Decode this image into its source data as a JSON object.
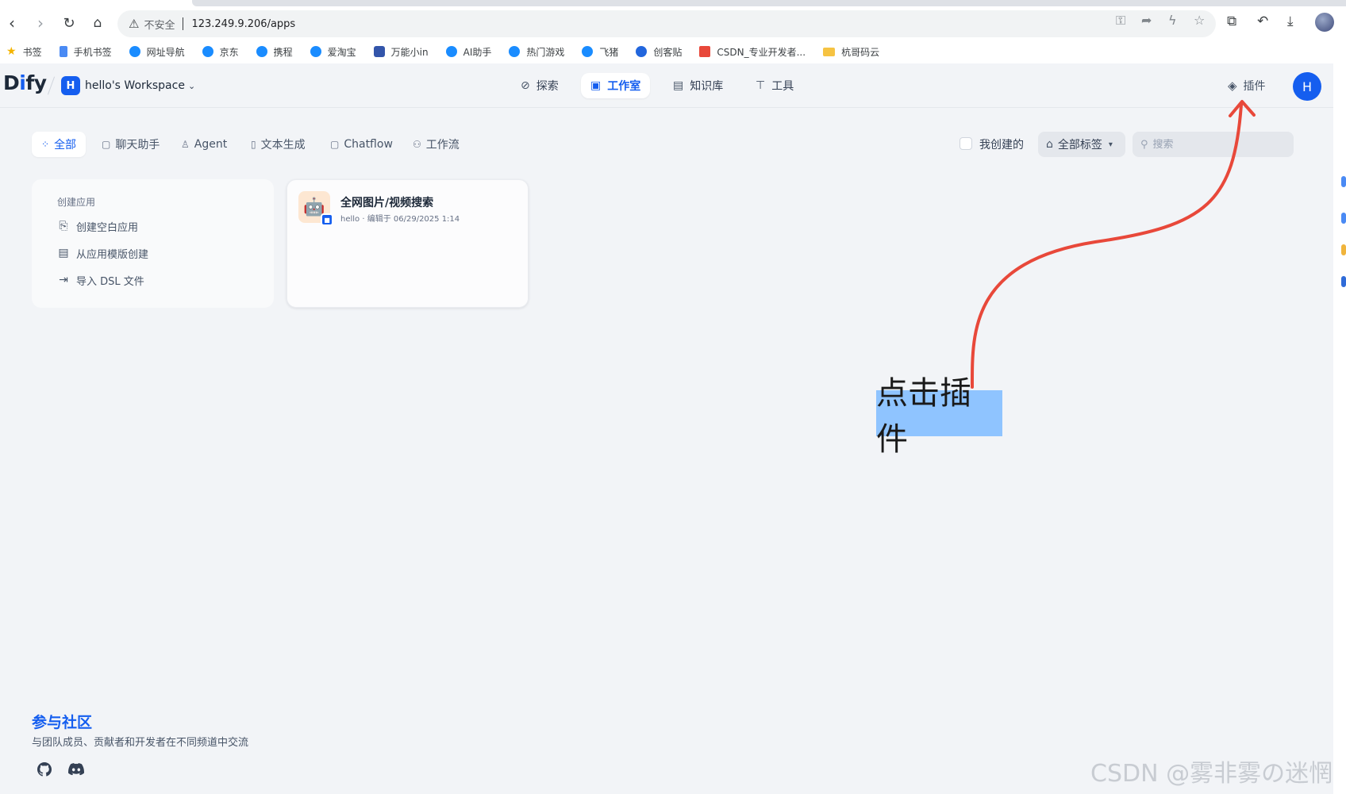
{
  "browser": {
    "insecure_label": "不安全",
    "url": "123.249.9.206/apps",
    "bookmarks": [
      {
        "label": "书签",
        "icon": "star-icon"
      },
      {
        "label": "手机书签",
        "icon": "phone-icon"
      },
      {
        "label": "网址导航",
        "icon": "edge-icon"
      },
      {
        "label": "京东",
        "icon": "edge-icon"
      },
      {
        "label": "携程",
        "icon": "edge-icon"
      },
      {
        "label": "爱淘宝",
        "icon": "edge-icon"
      },
      {
        "label": "万能小in",
        "icon": "robot-icon"
      },
      {
        "label": "AI助手",
        "icon": "edge-icon"
      },
      {
        "label": "热门游戏",
        "icon": "edge-icon"
      },
      {
        "label": "飞猪",
        "icon": "edge-icon"
      },
      {
        "label": "创客贴",
        "icon": "creator-icon"
      },
      {
        "label": "CSDN_专业开发者...",
        "icon": "csdn-icon"
      },
      {
        "label": "杭哥码云",
        "icon": "folder-icon"
      }
    ]
  },
  "header": {
    "logo": "Dify",
    "workspace_initial": "H",
    "workspace_name": "hello's Workspace",
    "nav": [
      {
        "label": "探索",
        "icon": "compass-icon"
      },
      {
        "label": "工作室",
        "icon": "robot-icon"
      },
      {
        "label": "知识库",
        "icon": "book-icon"
      },
      {
        "label": "工具",
        "icon": "hammer-icon"
      }
    ],
    "plugins_label": "插件",
    "user_initial": "H"
  },
  "filters": {
    "tabs": [
      {
        "label": "全部",
        "icon": "grid-icon"
      },
      {
        "label": "聊天助手",
        "icon": "chat-icon"
      },
      {
        "label": "Agent",
        "icon": "agent-icon"
      },
      {
        "label": "文本生成",
        "icon": "doc-icon"
      },
      {
        "label": "Chatflow",
        "icon": "chatflow-icon"
      },
      {
        "label": "工作流",
        "icon": "workflow-icon"
      }
    ],
    "mine_label": "我创建的",
    "tags_label": "全部标签",
    "search_placeholder": "搜索"
  },
  "create_card": {
    "title": "创建应用",
    "items": [
      {
        "label": "创建空白应用",
        "icon": "file-plus-icon"
      },
      {
        "label": "从应用模版创建",
        "icon": "template-icon"
      },
      {
        "label": "导入 DSL 文件",
        "icon": "import-icon"
      }
    ]
  },
  "apps": [
    {
      "name": "全网图片/视频搜索",
      "meta": "hello · 编辑于 06/29/2025 1:14"
    }
  ],
  "community": {
    "title": "参与社区",
    "description": "与团队成员、贡献者和开发者在不同频道中交流"
  },
  "annotation": {
    "label": "点击插件",
    "color": "#e8483a"
  },
  "watermark": "CSDN @雾非雾の迷惘",
  "colors": {
    "accent": "#155eef",
    "background": "#f2f4f7"
  }
}
